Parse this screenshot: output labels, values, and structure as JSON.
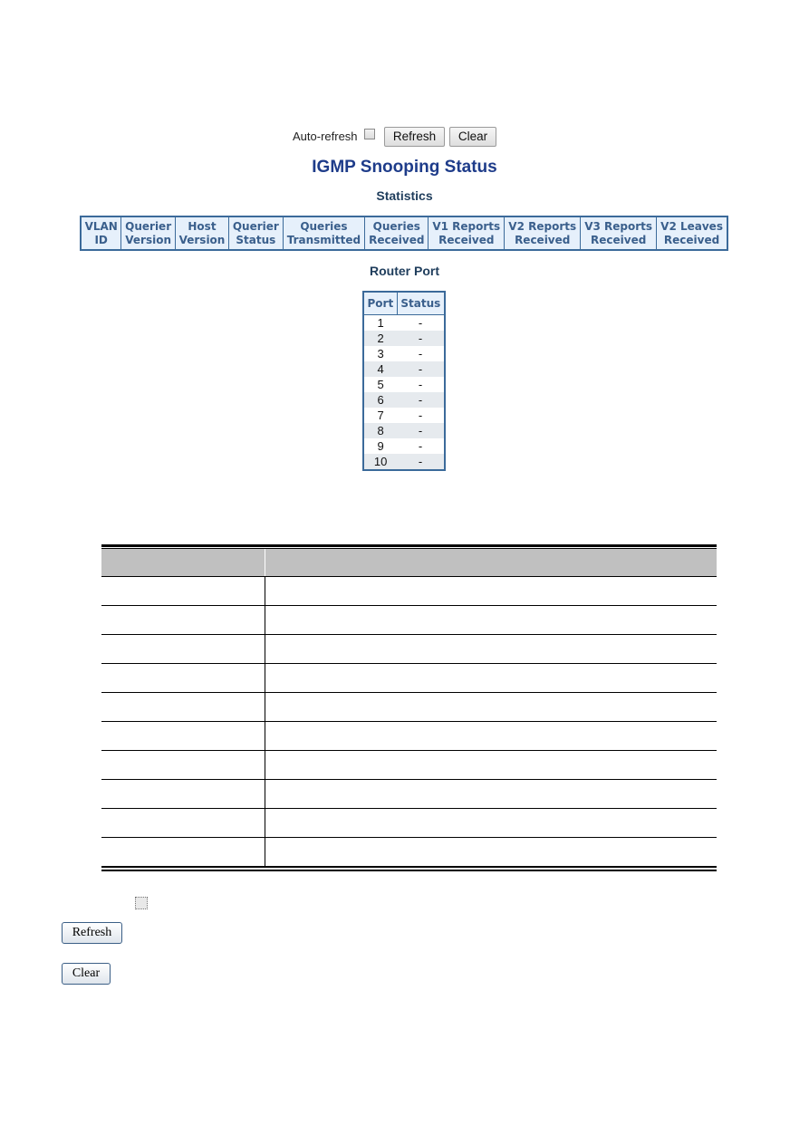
{
  "controls": {
    "auto_refresh_label": "Auto-refresh",
    "auto_refresh_checked": false,
    "refresh_label": "Refresh",
    "clear_label": "Clear"
  },
  "page": {
    "title": "IGMP Snooping Status",
    "statistics_heading": "Statistics",
    "router_port_heading": "Router Port"
  },
  "statistics_table": {
    "columns": [
      [
        "VLAN",
        "ID"
      ],
      [
        "Querier",
        "Version"
      ],
      [
        "Host",
        "Version"
      ],
      [
        "Querier",
        "Status"
      ],
      [
        "Queries",
        "Transmitted"
      ],
      [
        "Queries",
        "Received"
      ],
      [
        "V1 Reports",
        "Received"
      ],
      [
        "V2 Reports",
        "Received"
      ],
      [
        "V3 Reports",
        "Received"
      ],
      [
        "V2 Leaves",
        "Received"
      ]
    ],
    "rows": []
  },
  "router_port_table": {
    "columns": [
      "Port",
      "Status"
    ],
    "rows": [
      {
        "port": "1",
        "status": "-"
      },
      {
        "port": "2",
        "status": "-"
      },
      {
        "port": "3",
        "status": "-"
      },
      {
        "port": "4",
        "status": "-"
      },
      {
        "port": "5",
        "status": "-"
      },
      {
        "port": "6",
        "status": "-"
      },
      {
        "port": "7",
        "status": "-"
      },
      {
        "port": "8",
        "status": "-"
      },
      {
        "port": "9",
        "status": "-"
      },
      {
        "port": "10",
        "status": "-"
      }
    ]
  },
  "description_table": {
    "header": [
      "",
      ""
    ],
    "rows": [
      [
        "",
        ""
      ],
      [
        "",
        ""
      ],
      [
        "",
        ""
      ],
      [
        "",
        ""
      ],
      [
        "",
        ""
      ],
      [
        "",
        ""
      ],
      [
        "",
        ""
      ],
      [
        "",
        ""
      ],
      [
        "",
        ""
      ],
      [
        "",
        ""
      ]
    ]
  },
  "legend": {
    "auto_refresh_checked": false,
    "refresh_label": "Refresh",
    "clear_label": "Clear"
  },
  "colors": {
    "title": "#1e3c8a",
    "table_border": "#3b6a9a",
    "table_header_bg": "#e6f0fb",
    "table_header_text": "#3a5f8c",
    "row_alt_bg": "#e6eaee",
    "desc_header_bg": "#c0c0c0"
  }
}
